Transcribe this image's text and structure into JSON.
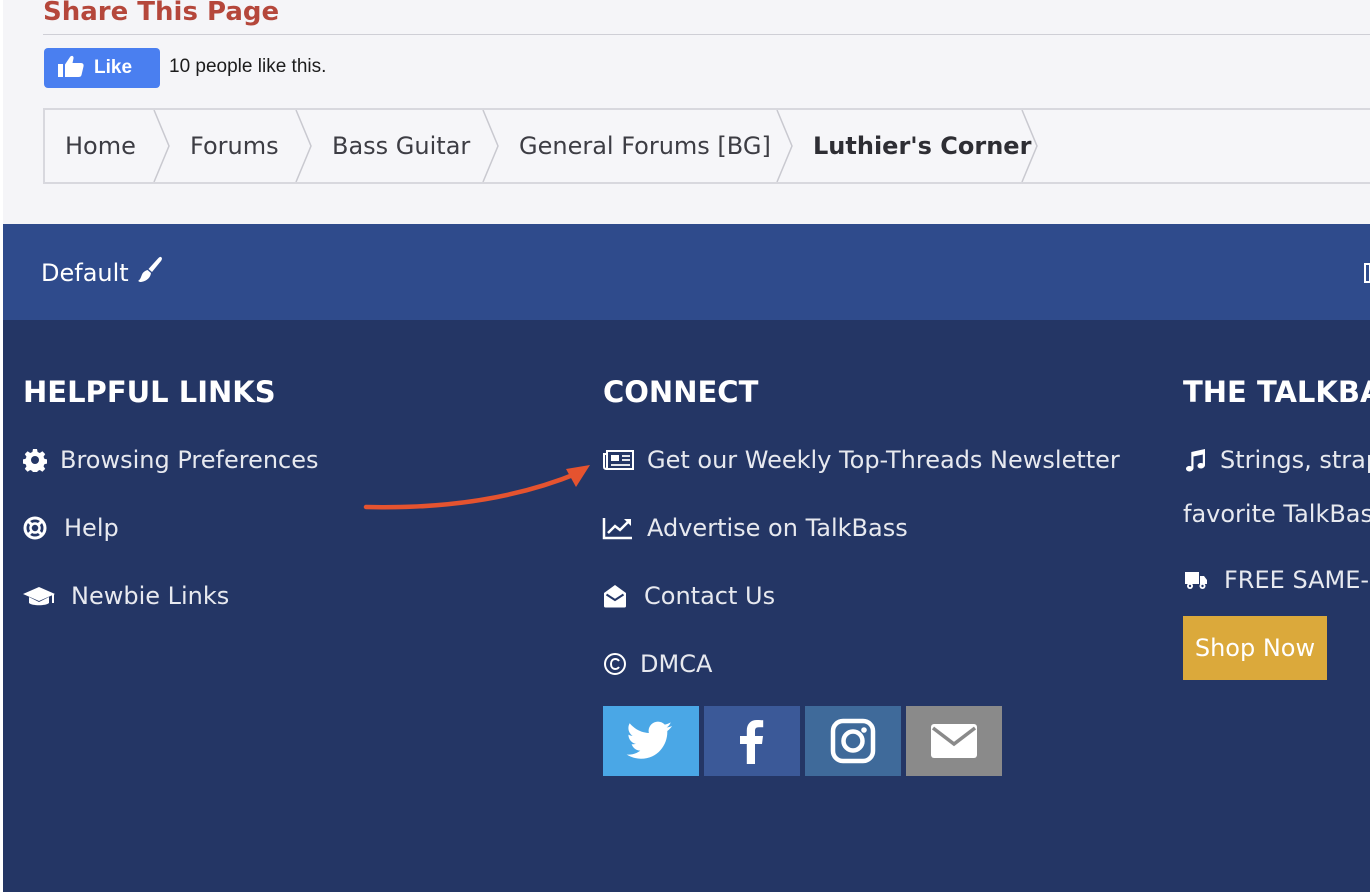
{
  "share": {
    "title": "Share This Page",
    "like_label": "Like",
    "like_count_text": "10 people like this."
  },
  "breadcrumb": [
    {
      "label": "Home"
    },
    {
      "label": "Forums"
    },
    {
      "label": "Bass Guitar"
    },
    {
      "label": "General Forums [BG]"
    },
    {
      "label": "Luthier's Corner",
      "current": true
    }
  ],
  "style_bar": {
    "label": "Default",
    "icon": "paintbrush-icon"
  },
  "footer": {
    "helpful": {
      "title": "HELPFUL LINKS",
      "links": [
        {
          "label": "Browsing Preferences",
          "icon": "gear-icon"
        },
        {
          "label": "Help",
          "icon": "lifebuoy-icon"
        },
        {
          "label": "Newbie Links",
          "icon": "graduation-cap-icon"
        }
      ]
    },
    "connect": {
      "title": "CONNECT",
      "links": [
        {
          "label": "Get our Weekly Top-Threads Newsletter",
          "icon": "newspaper-icon"
        },
        {
          "label": "Advertise on TalkBass",
          "icon": "line-chart-icon"
        },
        {
          "label": "Contact Us",
          "icon": "envelope-open-icon"
        },
        {
          "label": "DMCA",
          "icon": "copyright-icon"
        }
      ],
      "social": [
        {
          "name": "twitter",
          "icon": "twitter-icon",
          "color": "#4aa7e6"
        },
        {
          "name": "facebook",
          "icon": "facebook-icon",
          "color": "#3b5998"
        },
        {
          "name": "instagram",
          "icon": "instagram-icon",
          "color": "#3f6a9a"
        },
        {
          "name": "email",
          "icon": "envelope-icon",
          "color": "#8a8a8a"
        }
      ]
    },
    "store": {
      "title": "THE TALKBA",
      "line1": "Strings, strap",
      "line2": "favorite TalkBass",
      "line3": "FREE SAME-",
      "button": "Shop Now"
    }
  },
  "colors": {
    "share_title": "#b5473b",
    "like_button": "#4a7ff0",
    "style_bar": "#2f4b8c",
    "footer": "#243665",
    "shop_button": "#dba93b",
    "annotation_arrow": "#e5532f"
  }
}
